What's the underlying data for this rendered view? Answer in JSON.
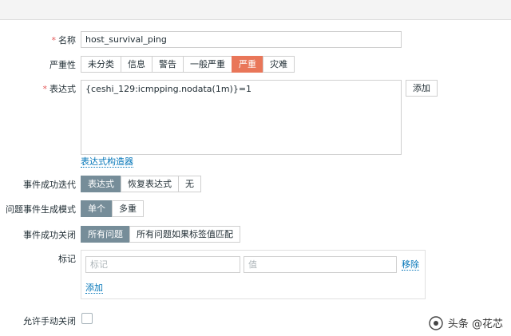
{
  "form": {
    "name": {
      "label": "名称",
      "value": "host_survival_ping"
    },
    "severity": {
      "label": "严重性",
      "options": [
        "未分类",
        "信息",
        "警告",
        "一般严重",
        "严重",
        "灾难"
      ],
      "selected": "严重"
    },
    "expression": {
      "label": "表达式",
      "value": "{ceshi_129:icmpping.nodata(1m)}=1",
      "add_button": "添加",
      "builder_link": "表达式构造器"
    },
    "ok_event_generation": {
      "label": "事件成功迭代",
      "options": [
        "表达式",
        "恢复表达式",
        "无"
      ],
      "selected": "表达式"
    },
    "problem_event_mode": {
      "label": "问题事件生成模式",
      "options": [
        "单个",
        "多重"
      ],
      "selected": "单个"
    },
    "ok_event_closes": {
      "label": "事件成功关闭",
      "options": [
        "所有问题",
        "所有问题如果标签值匹配"
      ],
      "selected": "所有问题"
    },
    "tags": {
      "label": "标记",
      "tag_placeholder": "标记",
      "value_placeholder": "值",
      "remove_link": "移除",
      "add_link": "添加"
    },
    "manual_close": {
      "label": "允许手动关闭",
      "checked": false
    }
  },
  "watermark": {
    "text": "头条 @花芯"
  },
  "colors": {
    "accent_red": "#e97659",
    "accent_blue": "#768d99",
    "link": "#0275b8"
  }
}
